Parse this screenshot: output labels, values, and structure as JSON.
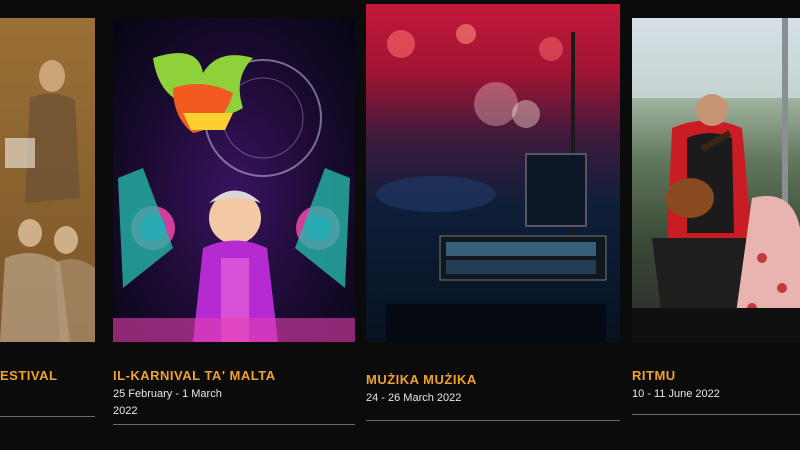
{
  "events": [
    {
      "title": "ESTIVAL",
      "date": ""
    },
    {
      "title": "IL-KARNIVAL TA' MALTA",
      "date": "25 February - 1 March 2022"
    },
    {
      "title": "MUŻIKA MUŻIKA",
      "date": "24 - 26 March 2022"
    },
    {
      "title": "RITMU",
      "date": "10 - 11 June 2022"
    }
  ],
  "colors": {
    "title": "#f0a22b",
    "background": "#0b0b0b",
    "date": "#e8e8e8"
  }
}
